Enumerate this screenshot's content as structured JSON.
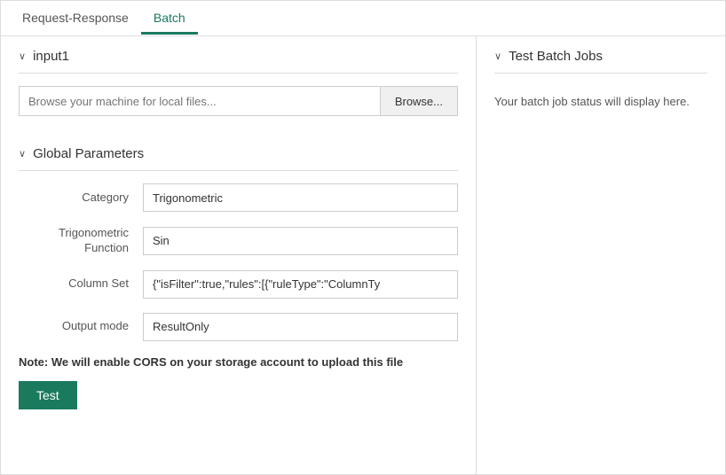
{
  "tabs": {
    "request_response": {
      "label": "Request-Response",
      "active": false
    },
    "batch": {
      "label": "Batch",
      "active": true
    }
  },
  "left_panel": {
    "input_section": {
      "title": "input1",
      "file_input": {
        "placeholder": "Browse your machine for local files...",
        "value": ""
      },
      "browse_button": "Browse..."
    },
    "global_params": {
      "title": "Global Parameters",
      "fields": [
        {
          "label": "Category",
          "value": "Trigonometric"
        },
        {
          "label": "Trigonometric\nFunction",
          "value": "Sin"
        },
        {
          "label": "Column Set",
          "value": "{\"isFilter\":true,\"rules\":[{\"ruleType\":\"ColumnTy"
        },
        {
          "label": "Output mode",
          "value": "ResultOnly"
        }
      ]
    },
    "note": "Note: We will enable CORS on your storage account to upload this file",
    "test_button": "Test"
  },
  "right_panel": {
    "title": "Test Batch Jobs",
    "status_message": "Your batch job status will display here."
  },
  "icons": {
    "chevron_down": "∨"
  }
}
